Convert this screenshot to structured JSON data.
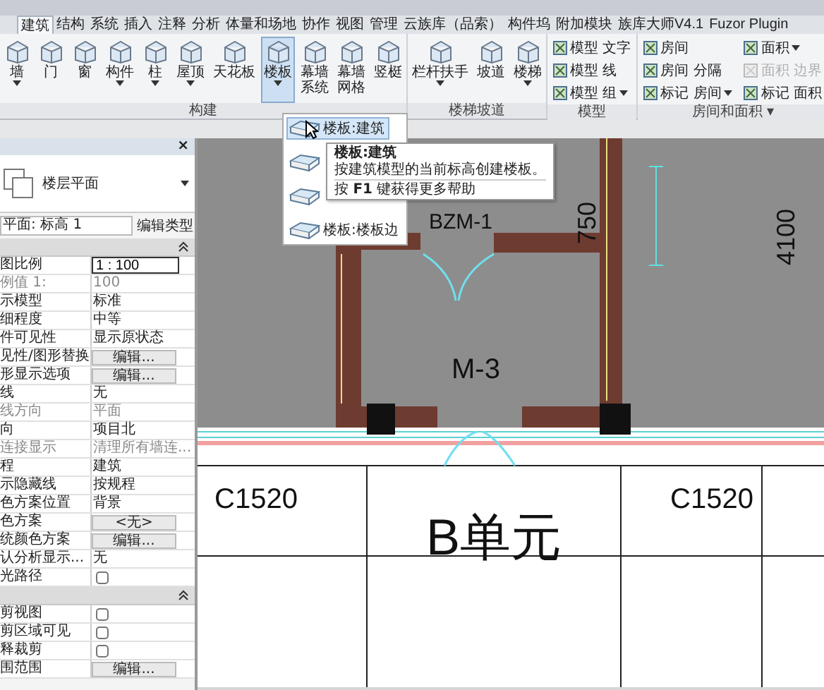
{
  "tabs": [
    {
      "label": "建筑",
      "selected": true
    },
    {
      "label": "结构",
      "selected": false
    },
    {
      "label": "系统",
      "selected": false
    },
    {
      "label": "插入",
      "selected": false
    },
    {
      "label": "注释",
      "selected": false
    },
    {
      "label": "分析",
      "selected": false
    },
    {
      "label": "体量和场地",
      "selected": false
    },
    {
      "label": "协作",
      "selected": false
    },
    {
      "label": "视图",
      "selected": false
    },
    {
      "label": "管理",
      "selected": false
    },
    {
      "label": "云族库（品索）",
      "selected": false
    },
    {
      "label": "构件坞",
      "selected": false
    },
    {
      "label": "附加模块",
      "selected": false
    },
    {
      "label": "族库大师V4.1",
      "selected": false
    },
    {
      "label": "Fuzor Plugin",
      "selected": false
    }
  ],
  "ribbon": {
    "groups": [
      {
        "label": "构建",
        "tools": [
          {
            "label": [
              "墙"
            ],
            "dropdown": true,
            "selected": false
          },
          {
            "label": [
              "门"
            ],
            "dropdown": false,
            "selected": false
          },
          {
            "label": [
              "窗"
            ],
            "dropdown": false,
            "selected": false
          },
          {
            "label": [
              "构件"
            ],
            "dropdown": true,
            "selected": false
          },
          {
            "label": [
              "柱"
            ],
            "dropdown": true,
            "selected": false
          },
          {
            "label": [
              "屋顶"
            ],
            "dropdown": true,
            "selected": false
          },
          {
            "label": [
              "天花板"
            ],
            "dropdown": false,
            "selected": false
          },
          {
            "label": [
              "楼板"
            ],
            "dropdown": true,
            "selected": true
          },
          {
            "label": [
              "幕墙",
              "系统"
            ],
            "dropdown": false,
            "selected": false
          },
          {
            "label": [
              "幕墙",
              "网格"
            ],
            "dropdown": false,
            "selected": false
          },
          {
            "label": [
              "竖梃"
            ],
            "dropdown": false,
            "selected": false
          }
        ]
      },
      {
        "label": "楼梯坡道",
        "tools": [
          {
            "label": [
              "栏杆扶手"
            ],
            "dropdown": true,
            "selected": false
          },
          {
            "label": [
              "坡道"
            ],
            "dropdown": false,
            "selected": false
          },
          {
            "label": [
              "楼梯"
            ],
            "dropdown": true,
            "selected": false
          }
        ]
      },
      {
        "label": "模型",
        "small_columns": [
          [
            {
              "label": "模型 文字",
              "dropdown": false,
              "disabled": false
            },
            {
              "label": "模型 线",
              "dropdown": false,
              "disabled": false
            },
            {
              "label": "模型 组",
              "dropdown": true,
              "disabled": false
            }
          ]
        ]
      },
      {
        "label": "房间和面积 ▾",
        "small_columns": [
          [
            {
              "label": "房间",
              "dropdown": false,
              "disabled": false
            },
            {
              "label": "房间 分隔",
              "dropdown": false,
              "disabled": false
            },
            {
              "label": "标记 房间",
              "dropdown": true,
              "disabled": false
            }
          ],
          [
            {
              "label": "面积",
              "dropdown": true,
              "disabled": false
            },
            {
              "label": "面积 边界",
              "dropdown": false,
              "disabled": true
            },
            {
              "label": "标记 面积",
              "dropdown": false,
              "disabled": false
            }
          ]
        ]
      }
    ]
  },
  "dropdown_menu": {
    "items": [
      {
        "label": "楼板:建筑",
        "selected": true
      },
      {
        "selected": false
      },
      {
        "selected": false
      },
      {
        "label": "楼板:楼板边",
        "selected": false
      }
    ]
  },
  "tooltip": {
    "title": "楼板:建筑",
    "description": "按建筑模型的当前标高创建楼板。",
    "help": "按 **F1** 键获得更多帮助"
  },
  "properties": {
    "close": "×",
    "type_name": "楼层平面",
    "instance": "平面: 标高 1",
    "edit_type": "编辑类型",
    "rows": [
      {
        "kind": "header"
      },
      {
        "kind": "input",
        "name": "图比例",
        "value": "1 : 100"
      },
      {
        "kind": "text",
        "name": "例值 1:",
        "value": "100",
        "disabled": true
      },
      {
        "kind": "text",
        "name": "示模型",
        "value": "标准",
        "disabled": false
      },
      {
        "kind": "text",
        "name": "细程度",
        "value": "中等",
        "disabled": false
      },
      {
        "kind": "text",
        "name": "件可见性",
        "value": "显示原状态",
        "disabled": false
      },
      {
        "kind": "button",
        "name": "见性/图形替换",
        "value": "编辑..."
      },
      {
        "kind": "button",
        "name": "形显示选项",
        "value": "编辑..."
      },
      {
        "kind": "text",
        "name": "线",
        "value": "无",
        "disabled": false
      },
      {
        "kind": "text",
        "name": "线方向",
        "value": "平面",
        "disabled": true
      },
      {
        "kind": "text",
        "name": "向",
        "value": "项目北",
        "disabled": false
      },
      {
        "kind": "text",
        "name": "连接显示",
        "value": "清理所有墙连...",
        "disabled": true
      },
      {
        "kind": "text",
        "name": "程",
        "value": "建筑",
        "disabled": false
      },
      {
        "kind": "text",
        "name": "示隐藏线",
        "value": "按规程",
        "disabled": false
      },
      {
        "kind": "text",
        "name": "色方案位置",
        "value": "背景",
        "disabled": false
      },
      {
        "kind": "button",
        "name": "色方案",
        "value": "<无>"
      },
      {
        "kind": "button",
        "name": "统颜色方案",
        "value": "编辑..."
      },
      {
        "kind": "text",
        "name": "认分析显示...",
        "value": "无",
        "disabled": false
      },
      {
        "kind": "checkbox",
        "name": "光路径",
        "checked": false
      },
      {
        "kind": "header"
      },
      {
        "kind": "checkbox",
        "name": "剪视图",
        "checked": false
      },
      {
        "kind": "checkbox",
        "name": "剪区域可见",
        "checked": false
      },
      {
        "kind": "checkbox",
        "name": "释裁剪",
        "checked": false
      },
      {
        "kind": "button",
        "name": "围范围",
        "value": "编辑..."
      }
    ]
  },
  "plan": {
    "door_tag": "BZM-1",
    "dimension_1": "750",
    "dimension_2": "4100",
    "room_tag": "M-3",
    "window_tag_1": "C1520",
    "unit_name": "B单元",
    "window_tag_2": "C1520"
  }
}
